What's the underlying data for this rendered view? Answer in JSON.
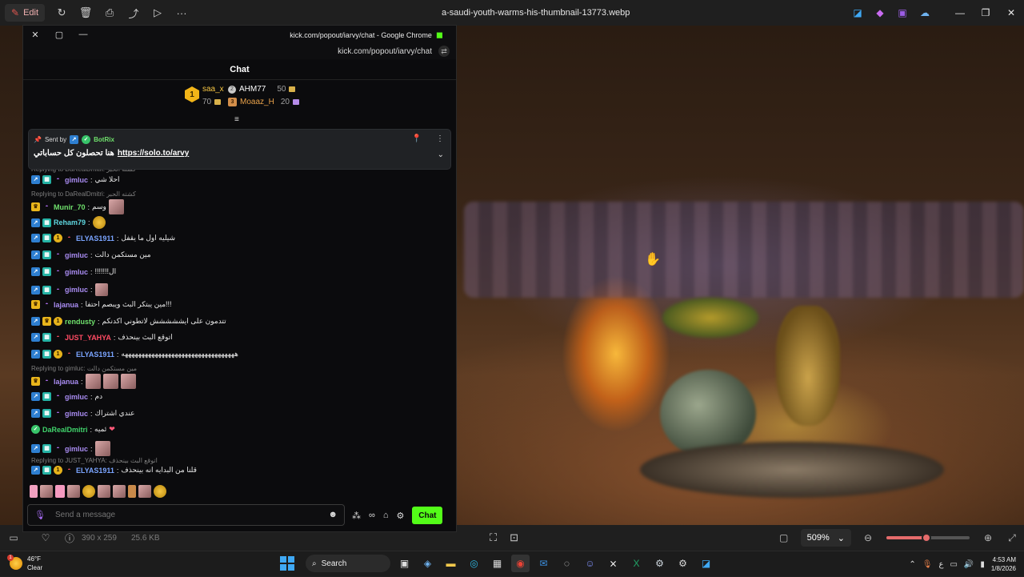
{
  "app": {
    "edit_label": "Edit",
    "file_title": "a-saudi-youth-warms-his-thumbnail-13773.webp"
  },
  "bottom": {
    "dimensions": "390 x 259",
    "filesize": "25.6 KB",
    "zoom": "509%",
    "zoom_level": 0.48
  },
  "popout": {
    "title": "kick.com/popout/iarvy/chat - Google Chrome",
    "url": "kick.com/popout/iarvy/chat",
    "chat_header": "Chat"
  },
  "leaderboard": {
    "rank1_badge": "1",
    "first": {
      "name": "saa_x",
      "points": "70"
    },
    "second": {
      "name": "AHM77",
      "points": "50"
    },
    "third": {
      "name": "Moaaz_H",
      "points": "20"
    }
  },
  "pinned": {
    "sent_by": "Sent by",
    "bot_name": "BotRix",
    "text": "هنا تحصلون كل حساباتي",
    "link": "https://solo.to/arvy"
  },
  "messages": [
    {
      "kind": "reply",
      "text": "Replying to DaRealDmitri: كشته الحبر"
    },
    {
      "kind": "msg",
      "user": "gimluc",
      "text": "احلا شي"
    },
    {
      "kind": "reply",
      "text": "Replying to DaRealDmitri: كشته الحبر"
    },
    {
      "kind": "msg",
      "user": "Munir_70",
      "text": "وسم"
    },
    {
      "kind": "msg",
      "user": "Reham79",
      "text": ""
    },
    {
      "kind": "msg",
      "user": "ELYAS1911",
      "text": "شيليه اول ما يقفل"
    },
    {
      "kind": "msg",
      "user": "gimluc",
      "text": "مين مستكمن دالت"
    },
    {
      "kind": "msg",
      "user": "gimluc",
      "text": "!!!!!!!ال"
    },
    {
      "kind": "msg",
      "user": "gimluc",
      "text": ""
    },
    {
      "kind": "msg",
      "user": "lajanua",
      "text": "مين يبتكر البث ويبصم احتفا!!!"
    },
    {
      "kind": "msg",
      "user": "rendusty",
      "text": "تتدمون على ايششششش لاتطوني اكدنكم"
    },
    {
      "kind": "msg",
      "user": "JUST_YAHYA",
      "text": "اتوقع البث بينحذف"
    },
    {
      "kind": "msg",
      "user": "ELYAS1911",
      "text": "ههههههههههههههههههههههههههههههههههه"
    },
    {
      "kind": "reply",
      "text": "Replying to gimluc: مين مستكمن دالت"
    },
    {
      "kind": "msg",
      "user": "lajanua",
      "text": ""
    },
    {
      "kind": "msg",
      "user": "gimluc",
      "text": "دم"
    },
    {
      "kind": "msg",
      "user": "gimluc",
      "text": "عندي اشتراك"
    },
    {
      "kind": "msg",
      "user": "DaRealDmitri",
      "text": "ئميه"
    },
    {
      "kind": "msg",
      "user": "gimluc",
      "text": ""
    },
    {
      "kind": "reply",
      "text": "Replying to JUST_YAHYA: اتوقع البث بينحذف"
    },
    {
      "kind": "msg",
      "user": "ELYAS1911",
      "text": "قلنا من البدايه انه بينحذف"
    }
  ],
  "composer": {
    "placeholder": "Send a message",
    "send_label": "Chat"
  },
  "taskbar": {
    "temp": "46°F",
    "condition": "Clear",
    "search_label": "Search",
    "time": "4:53 AM",
    "date": "1/8/2026",
    "weather_badge": "1",
    "lang": "ع"
  },
  "colors": {
    "kick_green": "#53fc18",
    "accent_red": "#e56b6b"
  }
}
